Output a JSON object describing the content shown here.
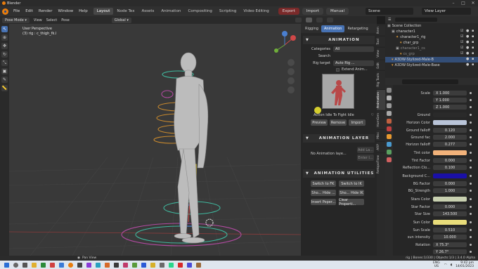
{
  "window": {
    "title": "Blender"
  },
  "menu": {
    "items": [
      "File",
      "Edit",
      "Render",
      "Window",
      "Help"
    ],
    "workspaces": [
      "Layout",
      "Node Tex",
      "Assets",
      "Animation",
      "Compositing",
      "Scripting",
      "Video Editing"
    ],
    "active_workspace": "Layout",
    "pills": [
      "Export",
      "Import",
      "Manual"
    ],
    "scene": "Scene",
    "view_layer": "View Layer"
  },
  "viewport_header": {
    "mode": "Pose Mode",
    "menus": [
      "View",
      "Select",
      "Pose"
    ],
    "orientation": "Global"
  },
  "viewport": {
    "line1": "User Perspective",
    "line2": "(3) rig : c_thigh_fk.l"
  },
  "npanel": {
    "tabs": [
      "Rigging",
      "Animation",
      "Retargeting"
    ],
    "active_tab": "Animation",
    "animation_title": "ANIMATION",
    "categories_label": "Categories",
    "categories_value": "All",
    "search_label": "Search",
    "rig_target_label": "Rig target",
    "rig_target_value": "Auto Rig ...",
    "extend_label": "Extend Anim...",
    "anim_name": "Action Idle To Fight Idle",
    "buttons": [
      "Preview",
      "Remove",
      "Import"
    ],
    "anim_layer_title": "ANIMATION LAYER",
    "no_layer": "No Animation laye...",
    "layer_buttons": [
      "Add La...",
      "Enter I..."
    ],
    "utilities_title": "ANIMATION UTILITIES",
    "util_buttons": [
      [
        "Switch to FK",
        "Switch to IK"
      ],
      [
        "Sho... Hide ...",
        "Sho... Hide IK"
      ],
      [
        "Insert Poper...",
        "Clear Properti..."
      ]
    ]
  },
  "vertical_tabs": [
    "Item",
    "Tool",
    "View",
    "Edit",
    "Rig Tools",
    "Animation",
    "HumGen",
    "Misc",
    "ARP",
    "RetopoFlow"
  ],
  "outliner": {
    "rows": [
      {
        "label": "Scene Collection",
        "indent": 0,
        "selected": false
      },
      {
        "label": "character1",
        "indent": 1,
        "selected": false
      },
      {
        "label": "character1_rig",
        "indent": 2,
        "selected": false
      },
      {
        "label": "char_grp",
        "indent": 3,
        "selected": false
      },
      {
        "label": "character1_cs",
        "indent": 2,
        "selected": false
      },
      {
        "label": "cs_grp",
        "indent": 3,
        "selected": false
      },
      {
        "label": "A3DW-Stylized-Male-B",
        "indent": 1,
        "selected": true
      },
      {
        "label": "A3DW-Stylized-Male-Base",
        "indent": 1,
        "selected": false
      }
    ]
  },
  "properties": {
    "rows": [
      {
        "label": "Scale",
        "value": "X 1.000"
      },
      {
        "label": "",
        "value": "Y 1.000"
      },
      {
        "label": "",
        "value": "Z 1.000"
      },
      {
        "label": "Ground",
        "value": "",
        "swatch": "#2a2a2a"
      },
      {
        "label": "Horizon Color",
        "value": "",
        "swatch": "#b9c4d8"
      },
      {
        "label": "Ground falloff",
        "value": "0.120"
      },
      {
        "label": "Ground fac",
        "value": "2.000"
      },
      {
        "label": "Horizon falloff",
        "value": "0.277"
      },
      {
        "label": "Tint color",
        "value": "",
        "swatch": "#f2b27a"
      },
      {
        "label": "Tint Factor",
        "value": "0.000"
      },
      {
        "label": "Reflection Clo...",
        "value": "0.100"
      },
      {
        "label": "Background C...",
        "value": "",
        "swatch": "#1a10a8"
      },
      {
        "label": "BG Factor",
        "value": "0.000"
      },
      {
        "label": "BG_Strength",
        "value": "1.000"
      },
      {
        "label": "Stars Color",
        "value": "",
        "swatch": "#c8d0b0"
      },
      {
        "label": "Star Factor",
        "value": "0.000"
      },
      {
        "label": "Star Size",
        "value": "143.500"
      },
      {
        "label": "Sun Color",
        "value": "",
        "swatch": "#e8dc7a"
      },
      {
        "label": "Sun Scale",
        "value": "0.510"
      },
      {
        "label": "sun intensity",
        "value": "10.000"
      },
      {
        "label": "Rotation",
        "value": "X 75.3°"
      },
      {
        "label": "",
        "value": "Y 26.7°"
      }
    ]
  },
  "statusbar": {
    "left": "Pan View",
    "right": "rig | Bones:1/330 | Objects:1/3 | 3.4.0 Alpha"
  },
  "taskbar": {
    "lang": "ENG",
    "region": "US",
    "time": "9:42 pm",
    "date": "14/01/2023"
  }
}
